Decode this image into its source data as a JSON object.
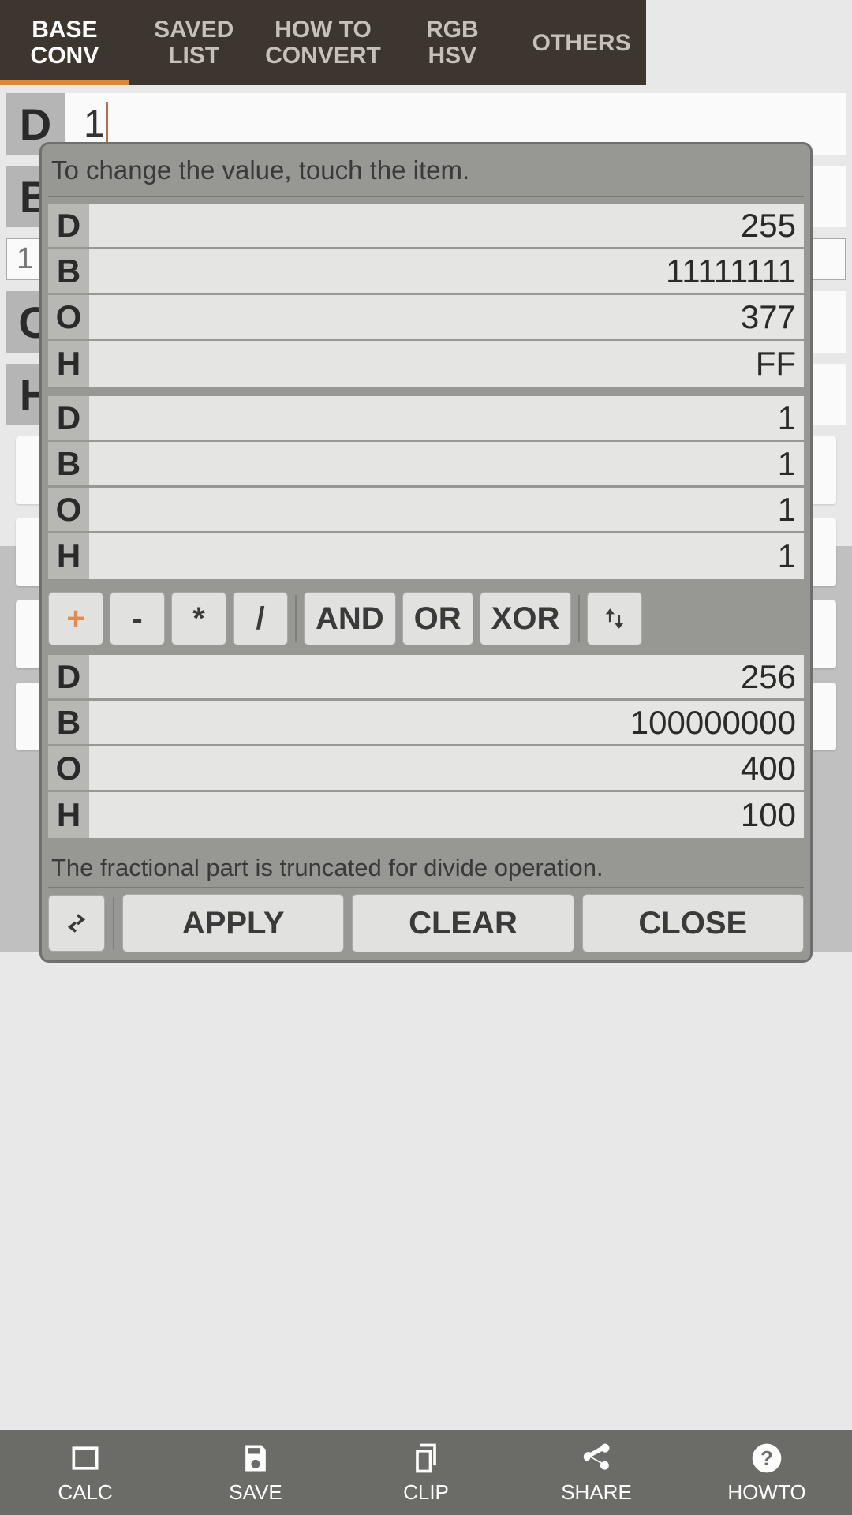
{
  "tabs": [
    {
      "label": "BASE\nCONV",
      "active": true
    },
    {
      "label": "SAVED\nLIST",
      "active": false
    },
    {
      "label": "HOW TO\nCONVERT",
      "active": false
    },
    {
      "label": "RGB\nHSV",
      "active": false
    },
    {
      "label": "OTHERS",
      "active": false
    }
  ],
  "bg": {
    "rows": [
      "D",
      "B",
      "O",
      "H"
    ],
    "input_value": "1",
    "mini": "1"
  },
  "dialog": {
    "hint": "To change the value, touch the item.",
    "group1": [
      {
        "k": "D",
        "v": "255"
      },
      {
        "k": "B",
        "v": "11111111"
      },
      {
        "k": "O",
        "v": "377"
      },
      {
        "k": "H",
        "v": "FF"
      }
    ],
    "group2": [
      {
        "k": "D",
        "v": "1"
      },
      {
        "k": "B",
        "v": "1"
      },
      {
        "k": "O",
        "v": "1"
      },
      {
        "k": "H",
        "v": "1"
      }
    ],
    "ops": {
      "plus": "+",
      "minus": "-",
      "mul": "*",
      "div": "/",
      "and": "AND",
      "or": "OR",
      "xor": "XOR"
    },
    "result": [
      {
        "k": "D",
        "v": "256"
      },
      {
        "k": "B",
        "v": "100000000"
      },
      {
        "k": "O",
        "v": "400"
      },
      {
        "k": "H",
        "v": "100"
      }
    ],
    "footnote": "The fractional part is truncated for divide operation.",
    "apply": "APPLY",
    "clear": "CLEAR",
    "close": "CLOSE"
  },
  "nav": {
    "calc": "CALC",
    "save": "SAVE",
    "clip": "CLIP",
    "share": "SHARE",
    "howto": "HOWTO"
  }
}
